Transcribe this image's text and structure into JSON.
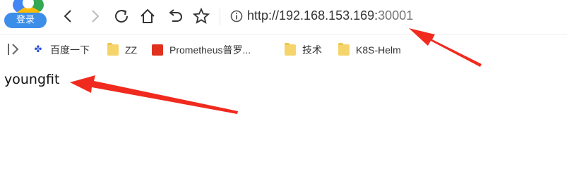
{
  "profile": {
    "login_label": "登录"
  },
  "address_bar": {
    "url_prefix": "http://192.168.153.169:",
    "url_port": "30001"
  },
  "icons": {
    "back": "chevron-left-icon",
    "forward": "chevron-right-icon",
    "reload": "reload-icon",
    "home": "home-icon",
    "undo": "undo-icon",
    "favorite": "star-icon",
    "info": "info-icon",
    "bookmarks_toggle": "bookmarks-bar-toggle-icon"
  },
  "bookmarks": [
    {
      "label": "百度一下",
      "icon": "baidu-icon"
    },
    {
      "label": "ZZ",
      "icon": "folder-icon"
    },
    {
      "label": "Prometheus普罗...",
      "icon": "prometheus-icon"
    },
    {
      "label": "技术",
      "icon": "folder-icon"
    },
    {
      "label": "K8S-Helm",
      "icon": "folder-icon"
    }
  ],
  "content": {
    "text": "youngfit"
  },
  "colors": {
    "annotation_arrow": "#f02a1e",
    "login_badge": "#3d8ee8",
    "folder": "#f5d56b"
  }
}
